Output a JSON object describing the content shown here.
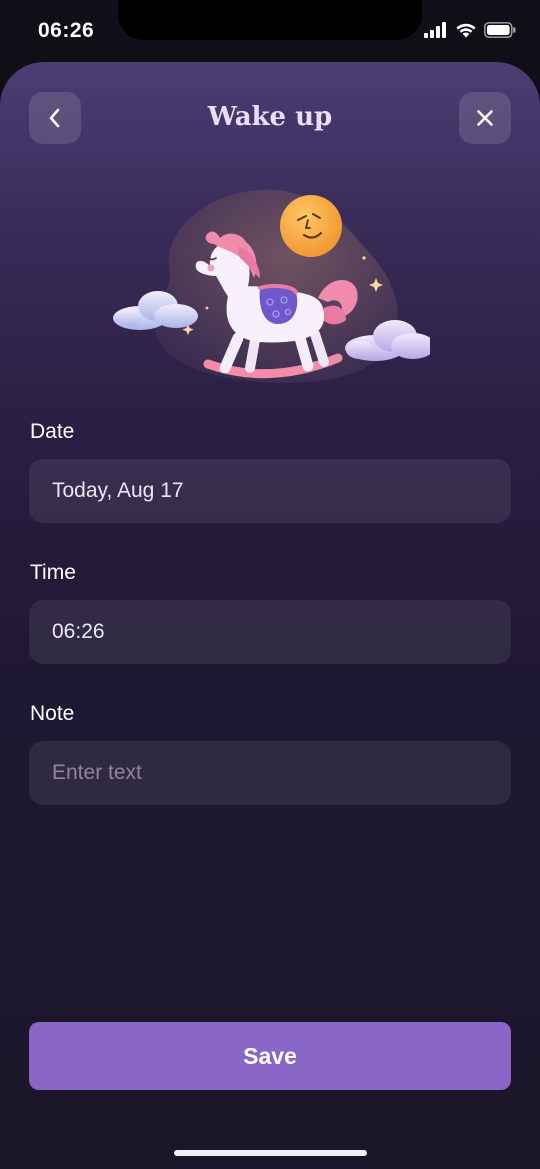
{
  "status_bar": {
    "time": "06:26",
    "icons": [
      "signal-icon",
      "wifi-icon",
      "battery-icon"
    ]
  },
  "header": {
    "title": "Wake up",
    "back_icon": "chevron-left-icon",
    "close_icon": "close-icon"
  },
  "illustration": {
    "subject": "rocking-horse-with-sun-and-clouds"
  },
  "form": {
    "date": {
      "label": "Date",
      "value": "Today, Aug 17"
    },
    "time": {
      "label": "Time",
      "value": "06:26"
    },
    "note": {
      "label": "Note",
      "value": "",
      "placeholder": "Enter text"
    }
  },
  "actions": {
    "save_label": "Save"
  },
  "colors": {
    "accent": "#8a67c6",
    "title": "#e9defd",
    "background_top": "#4c3d73",
    "background_bottom": "#1a1628"
  }
}
